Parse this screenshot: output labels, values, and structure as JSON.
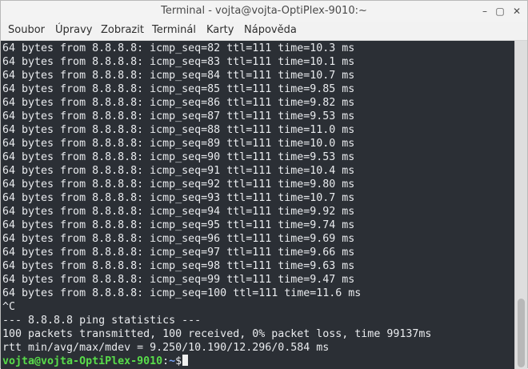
{
  "window": {
    "title": "Terminal - vojta@vojta-OptiPlex-9010:~",
    "controls": {
      "minimize": "–",
      "maximize": "▢",
      "close": "✕"
    }
  },
  "menu": [
    "Soubor",
    "Úpravy",
    "Zobrazit",
    "Terminál",
    "Karty",
    "Nápověda"
  ],
  "terminal": {
    "lines": [
      "64 bytes from 8.8.8.8: icmp_seq=82 ttl=111 time=10.3 ms",
      "64 bytes from 8.8.8.8: icmp_seq=83 ttl=111 time=10.1 ms",
      "64 bytes from 8.8.8.8: icmp_seq=84 ttl=111 time=10.7 ms",
      "64 bytes from 8.8.8.8: icmp_seq=85 ttl=111 time=9.85 ms",
      "64 bytes from 8.8.8.8: icmp_seq=86 ttl=111 time=9.82 ms",
      "64 bytes from 8.8.8.8: icmp_seq=87 ttl=111 time=9.53 ms",
      "64 bytes from 8.8.8.8: icmp_seq=88 ttl=111 time=11.0 ms",
      "64 bytes from 8.8.8.8: icmp_seq=89 ttl=111 time=10.0 ms",
      "64 bytes from 8.8.8.8: icmp_seq=90 ttl=111 time=9.53 ms",
      "64 bytes from 8.8.8.8: icmp_seq=91 ttl=111 time=10.4 ms",
      "64 bytes from 8.8.8.8: icmp_seq=92 ttl=111 time=9.80 ms",
      "64 bytes from 8.8.8.8: icmp_seq=93 ttl=111 time=10.7 ms",
      "64 bytes from 8.8.8.8: icmp_seq=94 ttl=111 time=9.92 ms",
      "64 bytes from 8.8.8.8: icmp_seq=95 ttl=111 time=9.74 ms",
      "64 bytes from 8.8.8.8: icmp_seq=96 ttl=111 time=9.69 ms",
      "64 bytes from 8.8.8.8: icmp_seq=97 ttl=111 time=9.66 ms",
      "64 bytes from 8.8.8.8: icmp_seq=98 ttl=111 time=9.63 ms",
      "64 bytes from 8.8.8.8: icmp_seq=99 ttl=111 time=9.47 ms",
      "64 bytes from 8.8.8.8: icmp_seq=100 ttl=111 time=11.6 ms",
      "^C",
      "--- 8.8.8.8 ping statistics ---",
      "100 packets transmitted, 100 received, 0% packet loss, time 99137ms",
      "rtt min/avg/max/mdev = 9.250/10.190/12.296/0.584 ms"
    ],
    "prompt": {
      "user_host": "vojta@vojta-OptiPlex-9010",
      "separator": ":",
      "path": "~",
      "symbol": "$"
    }
  }
}
